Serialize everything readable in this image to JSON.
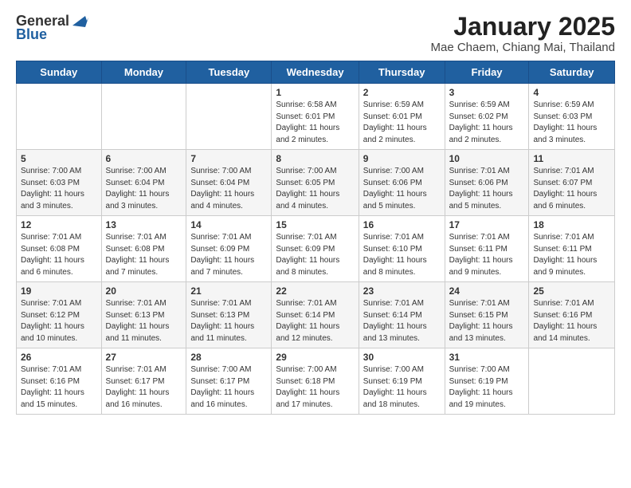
{
  "logo": {
    "line1": "General",
    "line2": "Blue"
  },
  "title": "January 2025",
  "subtitle": "Mae Chaem, Chiang Mai, Thailand",
  "days_of_week": [
    "Sunday",
    "Monday",
    "Tuesday",
    "Wednesday",
    "Thursday",
    "Friday",
    "Saturday"
  ],
  "weeks": [
    [
      {
        "day": "",
        "info": ""
      },
      {
        "day": "",
        "info": ""
      },
      {
        "day": "",
        "info": ""
      },
      {
        "day": "1",
        "info": "Sunrise: 6:58 AM\nSunset: 6:01 PM\nDaylight: 11 hours and 2 minutes."
      },
      {
        "day": "2",
        "info": "Sunrise: 6:59 AM\nSunset: 6:01 PM\nDaylight: 11 hours and 2 minutes."
      },
      {
        "day": "3",
        "info": "Sunrise: 6:59 AM\nSunset: 6:02 PM\nDaylight: 11 hours and 2 minutes."
      },
      {
        "day": "4",
        "info": "Sunrise: 6:59 AM\nSunset: 6:03 PM\nDaylight: 11 hours and 3 minutes."
      }
    ],
    [
      {
        "day": "5",
        "info": "Sunrise: 7:00 AM\nSunset: 6:03 PM\nDaylight: 11 hours and 3 minutes."
      },
      {
        "day": "6",
        "info": "Sunrise: 7:00 AM\nSunset: 6:04 PM\nDaylight: 11 hours and 3 minutes."
      },
      {
        "day": "7",
        "info": "Sunrise: 7:00 AM\nSunset: 6:04 PM\nDaylight: 11 hours and 4 minutes."
      },
      {
        "day": "8",
        "info": "Sunrise: 7:00 AM\nSunset: 6:05 PM\nDaylight: 11 hours and 4 minutes."
      },
      {
        "day": "9",
        "info": "Sunrise: 7:00 AM\nSunset: 6:06 PM\nDaylight: 11 hours and 5 minutes."
      },
      {
        "day": "10",
        "info": "Sunrise: 7:01 AM\nSunset: 6:06 PM\nDaylight: 11 hours and 5 minutes."
      },
      {
        "day": "11",
        "info": "Sunrise: 7:01 AM\nSunset: 6:07 PM\nDaylight: 11 hours and 6 minutes."
      }
    ],
    [
      {
        "day": "12",
        "info": "Sunrise: 7:01 AM\nSunset: 6:08 PM\nDaylight: 11 hours and 6 minutes."
      },
      {
        "day": "13",
        "info": "Sunrise: 7:01 AM\nSunset: 6:08 PM\nDaylight: 11 hours and 7 minutes."
      },
      {
        "day": "14",
        "info": "Sunrise: 7:01 AM\nSunset: 6:09 PM\nDaylight: 11 hours and 7 minutes."
      },
      {
        "day": "15",
        "info": "Sunrise: 7:01 AM\nSunset: 6:09 PM\nDaylight: 11 hours and 8 minutes."
      },
      {
        "day": "16",
        "info": "Sunrise: 7:01 AM\nSunset: 6:10 PM\nDaylight: 11 hours and 8 minutes."
      },
      {
        "day": "17",
        "info": "Sunrise: 7:01 AM\nSunset: 6:11 PM\nDaylight: 11 hours and 9 minutes."
      },
      {
        "day": "18",
        "info": "Sunrise: 7:01 AM\nSunset: 6:11 PM\nDaylight: 11 hours and 9 minutes."
      }
    ],
    [
      {
        "day": "19",
        "info": "Sunrise: 7:01 AM\nSunset: 6:12 PM\nDaylight: 11 hours and 10 minutes."
      },
      {
        "day": "20",
        "info": "Sunrise: 7:01 AM\nSunset: 6:13 PM\nDaylight: 11 hours and 11 minutes."
      },
      {
        "day": "21",
        "info": "Sunrise: 7:01 AM\nSunset: 6:13 PM\nDaylight: 11 hours and 11 minutes."
      },
      {
        "day": "22",
        "info": "Sunrise: 7:01 AM\nSunset: 6:14 PM\nDaylight: 11 hours and 12 minutes."
      },
      {
        "day": "23",
        "info": "Sunrise: 7:01 AM\nSunset: 6:14 PM\nDaylight: 11 hours and 13 minutes."
      },
      {
        "day": "24",
        "info": "Sunrise: 7:01 AM\nSunset: 6:15 PM\nDaylight: 11 hours and 13 minutes."
      },
      {
        "day": "25",
        "info": "Sunrise: 7:01 AM\nSunset: 6:16 PM\nDaylight: 11 hours and 14 minutes."
      }
    ],
    [
      {
        "day": "26",
        "info": "Sunrise: 7:01 AM\nSunset: 6:16 PM\nDaylight: 11 hours and 15 minutes."
      },
      {
        "day": "27",
        "info": "Sunrise: 7:01 AM\nSunset: 6:17 PM\nDaylight: 11 hours and 16 minutes."
      },
      {
        "day": "28",
        "info": "Sunrise: 7:00 AM\nSunset: 6:17 PM\nDaylight: 11 hours and 16 minutes."
      },
      {
        "day": "29",
        "info": "Sunrise: 7:00 AM\nSunset: 6:18 PM\nDaylight: 11 hours and 17 minutes."
      },
      {
        "day": "30",
        "info": "Sunrise: 7:00 AM\nSunset: 6:19 PM\nDaylight: 11 hours and 18 minutes."
      },
      {
        "day": "31",
        "info": "Sunrise: 7:00 AM\nSunset: 6:19 PM\nDaylight: 11 hours and 19 minutes."
      },
      {
        "day": "",
        "info": ""
      }
    ]
  ]
}
